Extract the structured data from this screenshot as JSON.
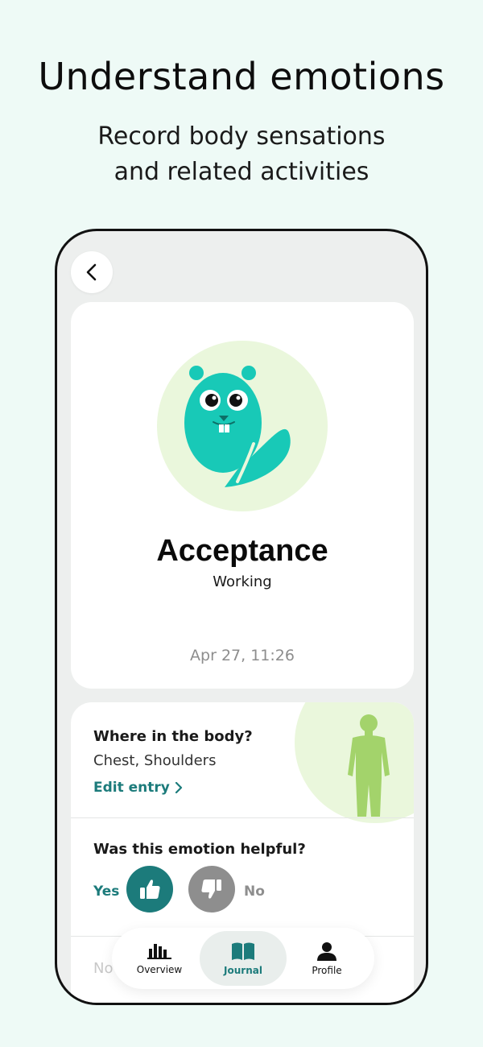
{
  "hero": {
    "title": "Understand emotions",
    "subtitle_line1": "Record body sensations",
    "subtitle_line2": "and related activities"
  },
  "emotion": {
    "name": "Acceptance",
    "activity": "Working",
    "date": "Apr 27, 11:26",
    "avatar_icon": "beaver-mascot-icon",
    "avatar_color": "#18c9b7",
    "avatar_bg": "#eaf7dc"
  },
  "details": {
    "body_question": "Where in the body?",
    "body_parts": "Chest, Shoulders",
    "edit_label": "Edit entry",
    "helpful_question": "Was this emotion helpful?",
    "yes_label": "Yes",
    "no_label": "No",
    "selected": "Yes",
    "faded_text": "No"
  },
  "tabs": [
    {
      "label": "Overview",
      "icon": "bar-chart-icon",
      "active": false
    },
    {
      "label": "Journal",
      "icon": "book-icon",
      "active": true
    },
    {
      "label": "Profile",
      "icon": "person-icon",
      "active": false
    }
  ],
  "colors": {
    "accent": "#1c7b7b",
    "page_bg": "#eefaf6",
    "body_figure": "#a3d36b",
    "muted": "#8e8e8e"
  }
}
